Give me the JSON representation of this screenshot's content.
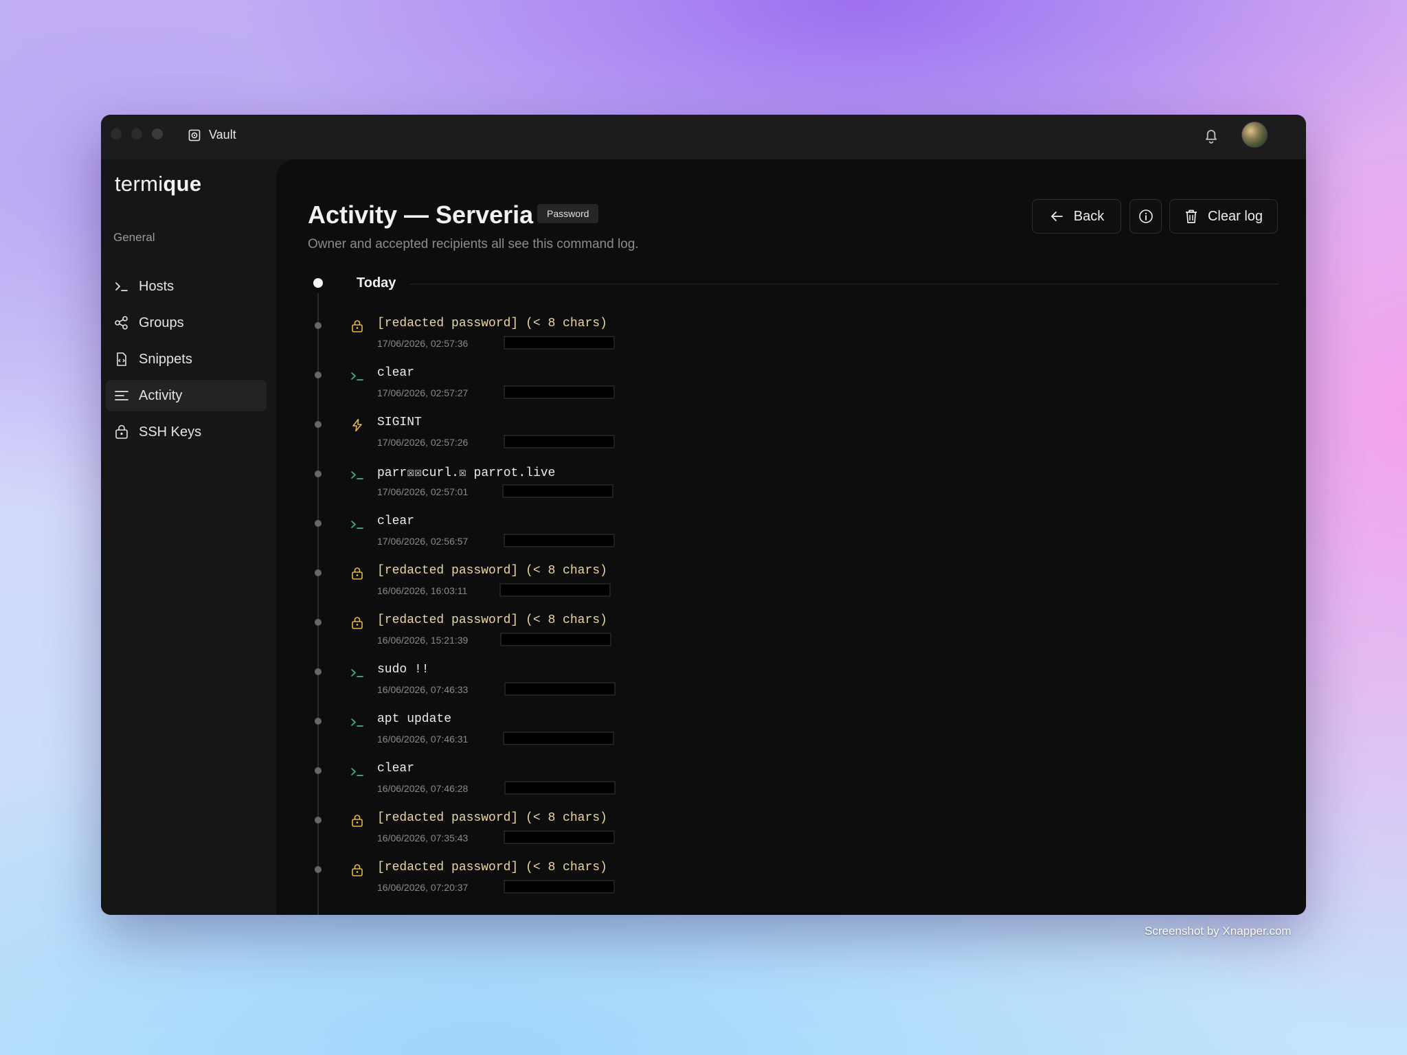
{
  "window": {
    "app_name": "Vault"
  },
  "sidebar": {
    "logo_light": "termi",
    "logo_bold": "que",
    "section": "General",
    "items": [
      {
        "label": "Hosts",
        "icon": "terminal-prompt-icon"
      },
      {
        "label": "Groups",
        "icon": "share-nodes-icon"
      },
      {
        "label": "Snippets",
        "icon": "file-code-icon"
      },
      {
        "label": "Activity",
        "icon": "list-lines-icon",
        "active": true
      },
      {
        "label": "SSH Keys",
        "icon": "lock-key-icon"
      }
    ]
  },
  "header": {
    "title": "Activity — Serveria",
    "badge": "Password",
    "subtitle": "Owner and accepted recipients all see this command log.",
    "back_label": "Back",
    "clear_label": "Clear log"
  },
  "timeline": {
    "group_label": "Today",
    "entries": [
      {
        "cmd": "[redacted password] (< 8 chars)",
        "time": "17/06/2026, 02:57:36",
        "kind": "password"
      },
      {
        "cmd": "clear",
        "time": "17/06/2026, 02:57:27",
        "kind": "command"
      },
      {
        "cmd": "SIGINT",
        "time": "17/06/2026, 02:57:26",
        "kind": "signal"
      },
      {
        "cmd": "parr☒☒curl.☒ parrot.live",
        "time": "17/06/2026, 02:57:01",
        "kind": "command"
      },
      {
        "cmd": "clear",
        "time": "17/06/2026, 02:56:57",
        "kind": "command"
      },
      {
        "cmd": "[redacted password] (< 8 chars)",
        "time": "16/06/2026, 16:03:11",
        "kind": "password"
      },
      {
        "cmd": "[redacted password] (< 8 chars)",
        "time": "16/06/2026, 15:21:39",
        "kind": "password"
      },
      {
        "cmd": "sudo !!",
        "time": "16/06/2026, 07:46:33",
        "kind": "command"
      },
      {
        "cmd": "apt update",
        "time": "16/06/2026, 07:46:31",
        "kind": "command"
      },
      {
        "cmd": "clear",
        "time": "16/06/2026, 07:46:28",
        "kind": "command"
      },
      {
        "cmd": "[redacted password] (< 8 chars)",
        "time": "16/06/2026, 07:35:43",
        "kind": "password"
      },
      {
        "cmd": "[redacted password] (< 8 chars)",
        "time": "16/06/2026, 07:20:37",
        "kind": "password"
      }
    ]
  },
  "colors": {
    "password": "#e8b84a",
    "command": "#3fb38c",
    "signal": "#e8b84a"
  },
  "watermark": "Screenshot by Xnapper.com"
}
